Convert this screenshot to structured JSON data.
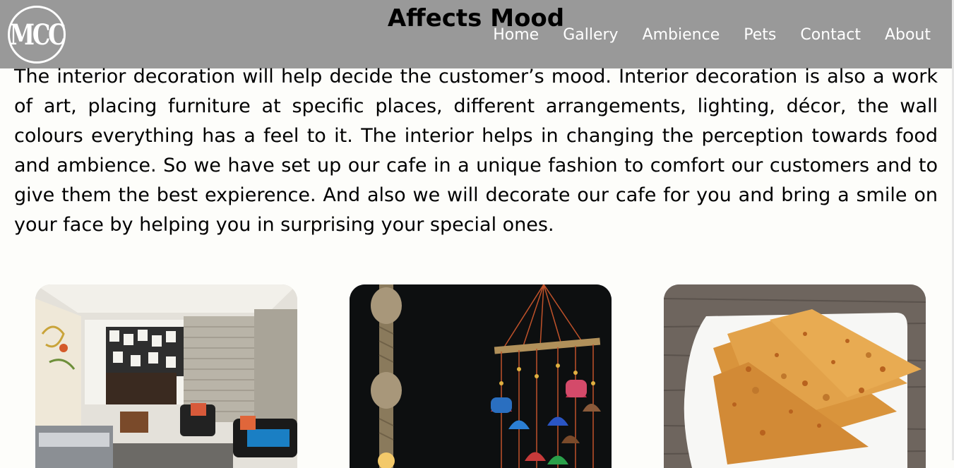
{
  "header": {
    "logo_text": "MCC",
    "title": "Affects Mood",
    "nav": [
      "Home",
      "Gallery",
      "Ambience",
      "Pets",
      "Contact",
      "About"
    ]
  },
  "intro": {
    "text": "The interior decoration will help decide the customer’s mood. Interior decoration is also a work of art, placing furniture at specific places, different arrangements, lighting, décor, the wall colours everything has a feel to it. The interior helps in changing the perception towards food and ambience. So we have set up our cafe in a unique fashion to comfort our customers and to give them the best expierence. And also we will decorate our cafe for you and bring a smile on your face by helping you in surprising your special ones."
  },
  "gallery": {
    "images": [
      "cafe-interior-photo",
      "wind-chimes-photo",
      "paratha-plate-photo"
    ]
  },
  "colors": {
    "header_bg": "#999999",
    "page_bg": "#fdfdfa",
    "nav_text": "#ffffff",
    "title_text": "#000000"
  }
}
